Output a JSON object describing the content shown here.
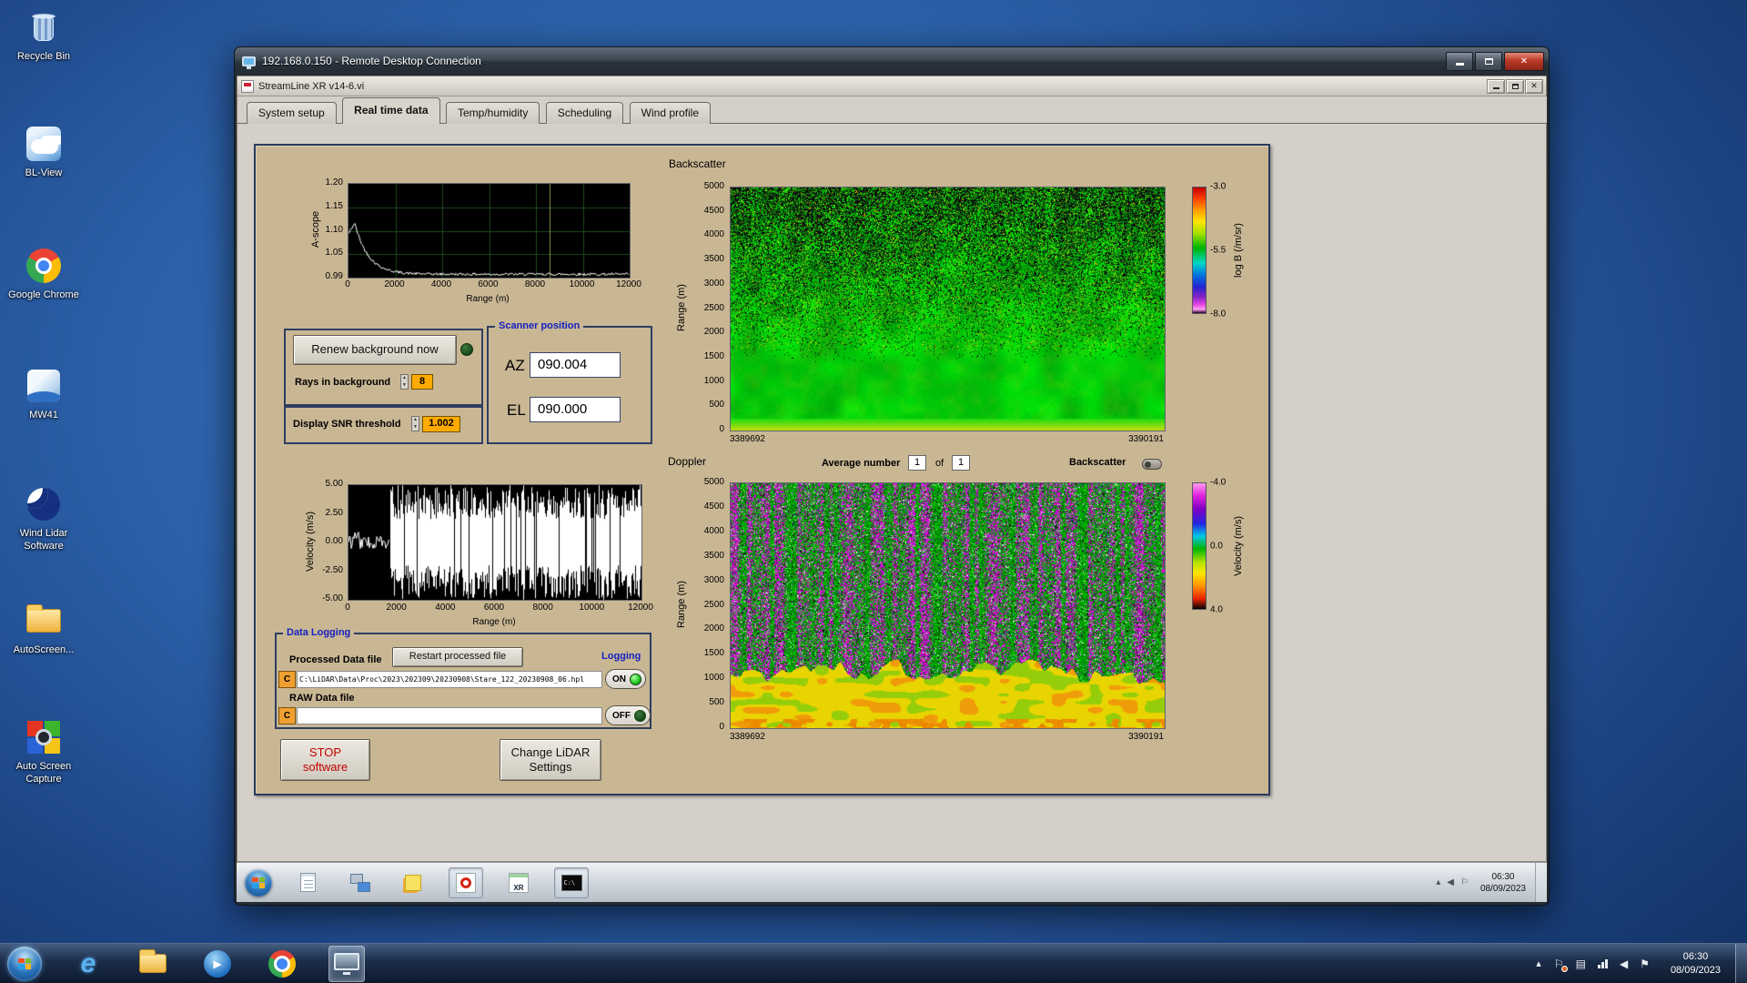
{
  "desktop": {
    "icons": [
      {
        "label": "Recycle Bin"
      },
      {
        "label": "BL-View"
      },
      {
        "label": "Google Chrome"
      },
      {
        "label": "MW41"
      },
      {
        "label": "Wind Lidar Software"
      },
      {
        "label": "AutoScreen..."
      },
      {
        "label": "Auto Screen Capture"
      }
    ]
  },
  "rdp_window": {
    "title": "192.168.0.150 - Remote Desktop Connection"
  },
  "app_window": {
    "title": "StreamLine XR v14-6.vi",
    "active_tab": "Real time data",
    "tabs": [
      {
        "label": "System setup"
      },
      {
        "label": "Real time data"
      },
      {
        "label": "Temp/humidity"
      },
      {
        "label": "Scheduling"
      },
      {
        "label": "Wind profile"
      }
    ]
  },
  "panel": {
    "ascope": {
      "ylabel": "A-scope",
      "xlabel": "Range (m)",
      "yticks": [
        "1.20",
        "1.15",
        "1.10",
        "1.05",
        "0.99"
      ],
      "xticks": [
        "0",
        "2000",
        "4000",
        "6000",
        "8000",
        "10000",
        "12000"
      ]
    },
    "background_controls": {
      "renew_button": "Renew background now",
      "rays_label": "Rays in background",
      "rays_value": "8",
      "snr_label": "Display SNR threshold",
      "snr_value": "1.002"
    },
    "scanner": {
      "title": "Scanner position",
      "az_label": "AZ",
      "az_value": "090.004",
      "el_label": "EL",
      "el_value": "090.000"
    },
    "backscatter": {
      "title": "Backscatter",
      "ylabel": "Range (m)",
      "yticks": [
        "5000",
        "4500",
        "4000",
        "3500",
        "3000",
        "2500",
        "2000",
        "1500",
        "1000",
        "500",
        "0"
      ],
      "x_start": "3389692",
      "x_end": "3390191",
      "colorbar": {
        "label": "log B (/m/sr)",
        "ticks": [
          "-3.0",
          "-5.5",
          "-8.0"
        ]
      }
    },
    "doppler": {
      "title": "Doppler",
      "average_label": "Average number",
      "average_value": "1",
      "of_label": "of",
      "of_count": "1",
      "backscatter_toggle_label": "Backscatter",
      "ylabel": "Range (m)",
      "yticks": [
        "5000",
        "4500",
        "4000",
        "3500",
        "3000",
        "2500",
        "2000",
        "1500",
        "1000",
        "500",
        "0"
      ],
      "x_start": "3389692",
      "x_end": "3390191",
      "colorbar": {
        "label": "Velocity (m/s)",
        "ticks": [
          "-4.0",
          "0.0",
          "4.0"
        ]
      }
    },
    "velocity": {
      "ylabel": "Velocity (m/s)",
      "xlabel": "Range (m)",
      "yticks": [
        "5.00",
        "2.50",
        "0.00",
        "-2.50",
        "-5.00"
      ],
      "xticks": [
        "0",
        "2000",
        "4000",
        "6000",
        "8000",
        "10000",
        "12000"
      ]
    },
    "data_logging": {
      "title": "Data Logging",
      "processed_label": "Processed Data file",
      "restart_button": "Restart processed file",
      "logging_label": "Logging",
      "drive": "C",
      "processed_path": "C:\\LiDAR\\Data\\Proc\\2023\\202309\\20230908\\Stare_122_20230908_06.hpl",
      "on_label": "ON",
      "raw_label": "RAW Data file",
      "raw_path": "",
      "off_label": "OFF"
    },
    "stop_button_line1": "STOP",
    "stop_button_line2": "software",
    "change_button_line1": "Change LiDAR",
    "change_button_line2": "Settings"
  },
  "remote_taskbar": {
    "xr_icon_label": "XR",
    "terminal_icon_label": "C:\\",
    "clock_time": "06:30",
    "clock_date": "08/09/2023"
  },
  "host_taskbar": {
    "clock_time": "06:30",
    "clock_date": "08/09/2023"
  }
}
